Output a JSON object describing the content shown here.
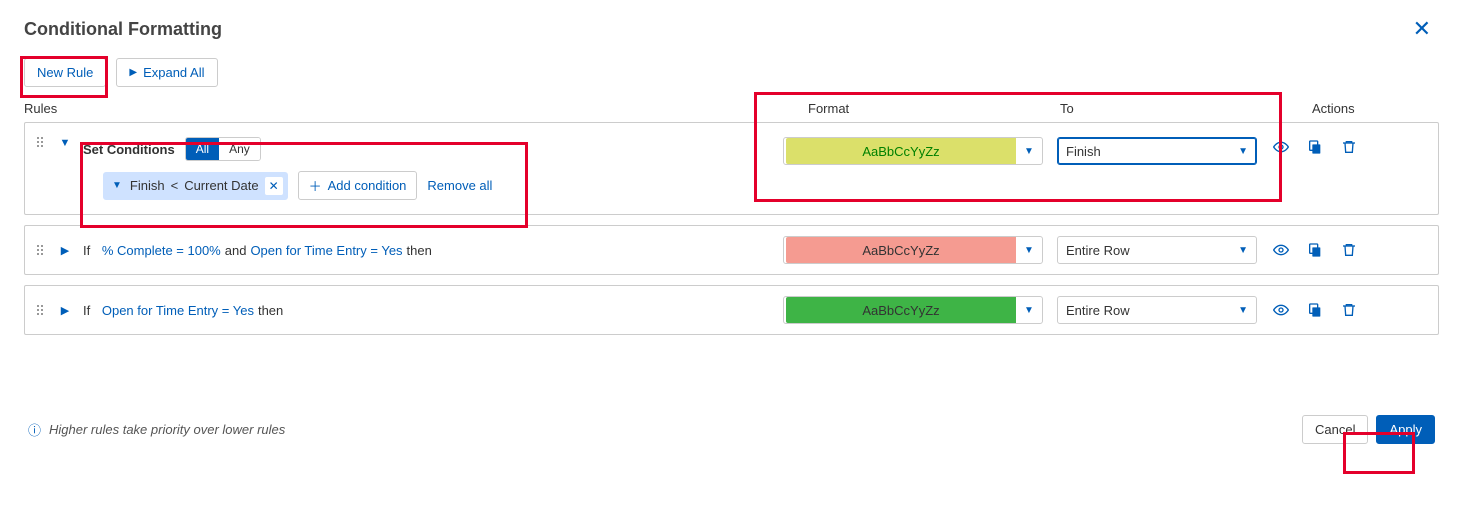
{
  "dialog": {
    "title": "Conditional Formatting"
  },
  "toolbar": {
    "new_rule": "New Rule",
    "expand_all": "Expand All"
  },
  "columns": {
    "rules": "Rules",
    "format": "Format",
    "to": "To",
    "actions": "Actions"
  },
  "set_conditions": {
    "label": "Set Conditions",
    "toggle_all": "All",
    "toggle_any": "Any",
    "active_toggle": "All"
  },
  "rules": [
    {
      "expanded": true,
      "condition": {
        "field": "Finish",
        "operator": "<",
        "value": "Current Date"
      },
      "add_condition": "Add condition",
      "remove_all": "Remove all",
      "format": {
        "preview_text": "AaBbCcYyZz",
        "bg": "#dbe06a",
        "fg": "#008000"
      },
      "to": "Finish"
    },
    {
      "expanded": false,
      "summary_prefix": "If",
      "summary_parts": [
        {
          "type": "link",
          "text": "% Complete = 100%"
        },
        {
          "type": "text",
          "text": " and "
        },
        {
          "type": "link",
          "text": "Open for Time Entry = Yes"
        },
        {
          "type": "text",
          "text": " then"
        }
      ],
      "format": {
        "preview_text": "AaBbCcYyZz",
        "bg": "#f59b91",
        "fg": "#333"
      },
      "to": "Entire Row"
    },
    {
      "expanded": false,
      "summary_prefix": "If",
      "summary_parts": [
        {
          "type": "link",
          "text": "Open for Time Entry = Yes"
        },
        {
          "type": "text",
          "text": " then"
        }
      ],
      "format": {
        "preview_text": "AaBbCcYyZz",
        "bg": "#3eb446",
        "fg": "#333"
      },
      "to": "Entire Row"
    }
  ],
  "footer": {
    "hint": "Higher rules take priority over lower rules",
    "cancel": "Cancel",
    "apply": "Apply"
  }
}
